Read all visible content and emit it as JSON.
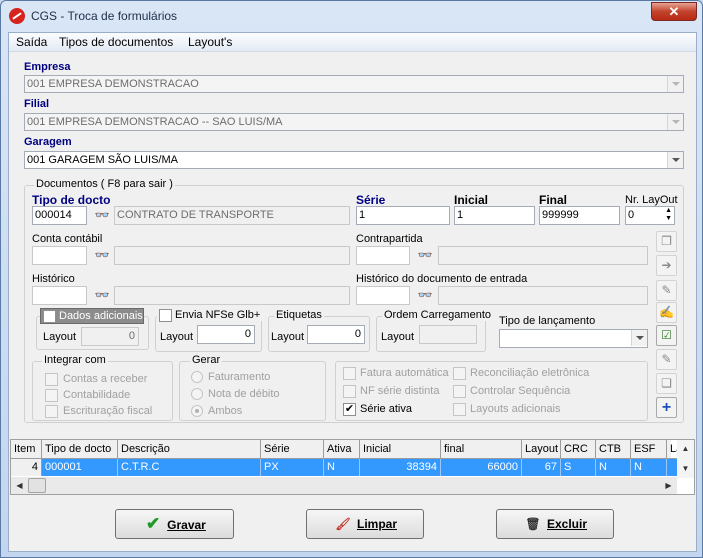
{
  "window": {
    "title": "CGS - Troca de formulários",
    "close_glyph": "✕"
  },
  "menu": {
    "items": [
      "Saída",
      "Tipos de documentos",
      "Layout's"
    ]
  },
  "empresa": {
    "label": "Empresa",
    "value": "001 EMPRESA DEMONSTRACAO"
  },
  "filial": {
    "label": "Filial",
    "value": "001 EMPRESA DEMONSTRACAO -- SAO LUIS/MA"
  },
  "garagem": {
    "label": "Garagem",
    "value": "001 GARAGEM SÃO LUIS/MA"
  },
  "documentos": {
    "group_label": "Documentos ( F8 para sair )",
    "tipo_docto_label": "Tipo de docto",
    "tipo_docto_code": "000014",
    "tipo_docto_desc": "CONTRATO DE TRANSPORTE",
    "serie_label": "Série",
    "serie_value": "1",
    "inicial_label": "Inicial",
    "inicial_value": "1",
    "final_label": "Final",
    "final_value": "999999",
    "nr_layout_label": "Nr. LayOut",
    "nr_layout_value": "0",
    "conta_contabil_label": "Conta contábil",
    "contrapartida_label": "Contrapartida",
    "historico_label": "Histórico",
    "historico_entrada_label": "Histórico do documento de entrada",
    "dados_adicionais": {
      "label": "Dados adicionais",
      "layout_label": "Layout",
      "layout_value": "0"
    },
    "envia_nfse": {
      "label": "Envia NFSe Glb+",
      "layout_label": "Layout",
      "layout_value": "0"
    },
    "etiquetas": {
      "label": "Etiquetas",
      "layout_label": "Layout",
      "layout_value": "0"
    },
    "ordem_carregamento": {
      "label": "Ordem Carregamento",
      "layout_label": "Layout",
      "layout_value": ""
    },
    "tipo_lancamento_label": "Tipo de lançamento",
    "tipo_lancamento_value": "",
    "integrar_com": {
      "label": "Integrar com",
      "options": [
        "Contas a receber",
        "Contabilidade",
        "Escrituração fiscal"
      ]
    },
    "gerar": {
      "label": "Gerar",
      "options": [
        "Faturamento",
        "Nota de débito",
        "Ambos"
      ],
      "selected": "Ambos"
    },
    "flags_left": [
      {
        "label": "Fatura automática",
        "checked": false
      },
      {
        "label": "NF série distinta",
        "checked": false
      },
      {
        "label": "Série ativa",
        "checked": true
      }
    ],
    "flags_right": [
      {
        "label": "Reconciliação eletrônica",
        "checked": false
      },
      {
        "label": "Controlar Sequência",
        "checked": false
      },
      {
        "label": "Layouts adicionais",
        "checked": false
      }
    ]
  },
  "table": {
    "columns": [
      "Item",
      "Tipo de docto",
      "Descrição",
      "Série",
      "Ativa",
      "Inicial",
      "final",
      "Layout",
      "CRC",
      "CTB",
      "ESF",
      "La"
    ],
    "rows": [
      [
        "4",
        "000001",
        "C.T.R.C",
        "PX",
        "N",
        "38394",
        "66000",
        "67",
        "S",
        "N",
        "N",
        ""
      ]
    ]
  },
  "buttons": {
    "gravar": "Gravar",
    "limpar": "Limpar",
    "excluir": "Excluir"
  },
  "icons": {
    "binoculars": "binoculars-icon",
    "check": "check-icon",
    "broom": "broom-icon",
    "trash": "trash-icon"
  }
}
